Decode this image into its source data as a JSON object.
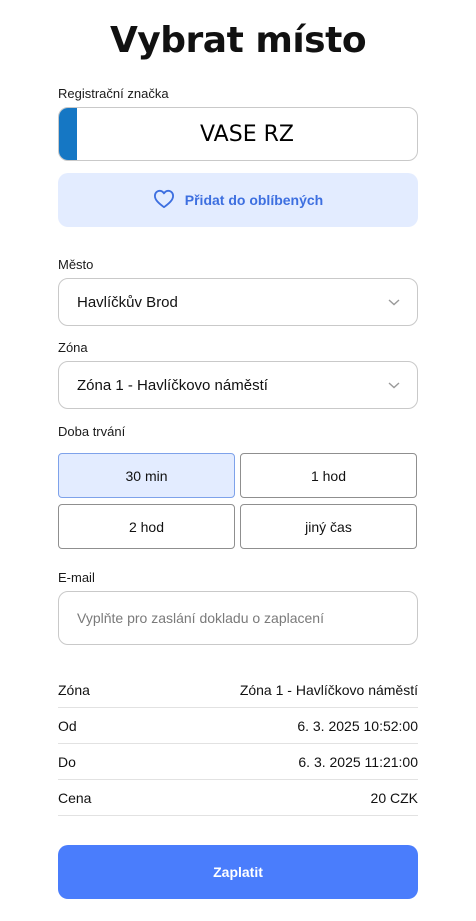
{
  "title": "Vybrat místo",
  "plate": {
    "label": "Registrační značka",
    "value": "VASE RZ"
  },
  "favorite_button": {
    "label": "Přidat do oblíbených",
    "icon": "heart-icon"
  },
  "city": {
    "label": "Město",
    "value": "Havlíčkův Brod"
  },
  "zone": {
    "label": "Zóna",
    "value": "Zóna 1 - Havlíčkovo náměstí"
  },
  "duration": {
    "label": "Doba trvání",
    "options": [
      "30 min",
      "1 hod",
      "2 hod",
      "jiný čas"
    ],
    "selected": "30 min"
  },
  "email": {
    "label": "E-mail",
    "placeholder": "Vyplňte pro zaslání dokladu o zaplacení"
  },
  "summary": [
    {
      "key": "Zóna",
      "value": "Zóna 1 - Havlíčkovo náměstí"
    },
    {
      "key": "Od",
      "value": "6. 3. 2025 10:52:00"
    },
    {
      "key": "Do",
      "value": "6. 3. 2025 11:21:00"
    },
    {
      "key": "Cena",
      "value": "20 CZK"
    }
  ],
  "pay_button": {
    "label": "Zaplatit"
  },
  "colors": {
    "accent": "#4a7dfc",
    "plate_stripe": "#1577c4",
    "favorite_bg": "#e3ecff",
    "favorite_text": "#3d6fe0"
  }
}
